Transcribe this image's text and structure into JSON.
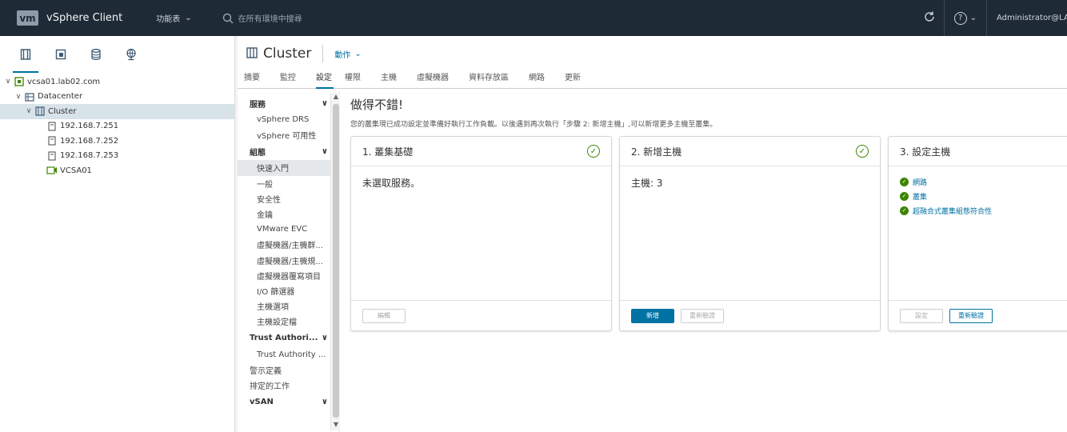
{
  "header": {
    "logo": "vm",
    "app_title": "vSphere Client",
    "menu_label": "功能表",
    "search_placeholder": "在所有環境中搜尋",
    "user": "Administrator@LA"
  },
  "tree": {
    "items": [
      {
        "label": "vcsa01.lab02.com",
        "icon": "vcenter-icon",
        "level": 0,
        "caret": "v"
      },
      {
        "label": "Datacenter",
        "icon": "datacenter-icon",
        "level": 1,
        "caret": "v"
      },
      {
        "label": "Cluster",
        "icon": "cluster-icon",
        "level": 2,
        "caret": "v",
        "selected": true
      },
      {
        "label": "192.168.7.251",
        "icon": "host-icon",
        "level": 3
      },
      {
        "label": "192.168.7.252",
        "icon": "host-icon",
        "level": 3
      },
      {
        "label": "192.168.7.253",
        "icon": "host-icon",
        "level": 3
      },
      {
        "label": "VCSA01",
        "icon": "vm-icon",
        "level": 3
      }
    ]
  },
  "object": {
    "title": "Cluster",
    "actions_label": "動作"
  },
  "tabs": [
    "摘要",
    "監控",
    "設定",
    "權限",
    "主機",
    "虛擬機器",
    "資料存放區",
    "網路",
    "更新"
  ],
  "subnav": {
    "groups": [
      {
        "label": "服務",
        "items": [
          "vSphere DRS",
          "vSphere 可用性"
        ]
      },
      {
        "label": "組態",
        "items": [
          "快速入門",
          "一般",
          "安全性",
          "金鑰",
          "VMware EVC",
          "虛擬機器/主機群...",
          "虛擬機器/主機規...",
          "虛擬機器覆寫項目",
          "I/O 篩選器",
          "主機選項",
          "主機設定檔"
        ]
      },
      {
        "label": "Trust Authori...",
        "items": [
          "Trust Authority ..."
        ]
      }
    ],
    "top_items": [
      "警示定義",
      "排定的工作"
    ],
    "last_group": "vSAN"
  },
  "content": {
    "title": "做得不錯!",
    "description": "您的叢集現已成功設定並準備好執行工作負載。以後遇到再次執行「步驟 2: 新增主機」,可以新增更多主機至叢集。",
    "cards": [
      {
        "title": "1. 叢集基礎",
        "body": "未選取服務。",
        "buttons": [
          {
            "label": "編輯",
            "style": "disabled"
          }
        ]
      },
      {
        "title": "2. 新增主機",
        "body": "主機: 3",
        "buttons": [
          {
            "label": "新增",
            "style": "primary"
          },
          {
            "label": "重新驗證",
            "style": "disabled"
          }
        ]
      },
      {
        "title": "3. 設定主機",
        "lines": [
          "網路",
          "叢集",
          "超融合式叢集組態符合性"
        ],
        "buttons": [
          {
            "label": "設定",
            "style": "disabled"
          },
          {
            "label": "重新驗證",
            "style": "outline"
          }
        ]
      }
    ]
  }
}
